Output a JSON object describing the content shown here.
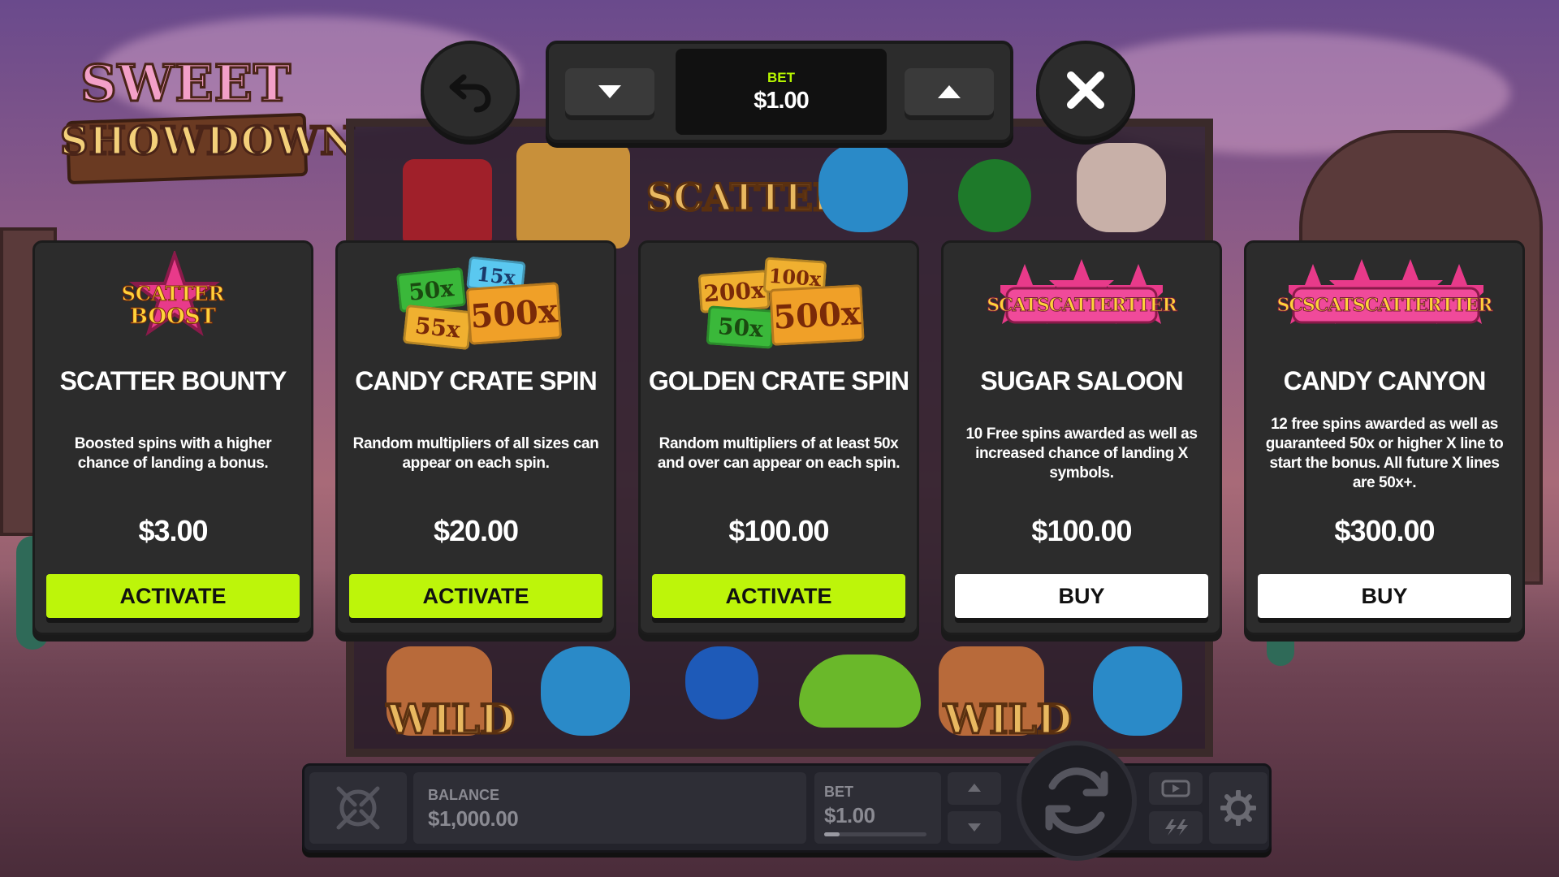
{
  "logo": {
    "line1": "SWEET",
    "line2": "SHOWDOWN"
  },
  "top_bar": {
    "back_icon": "undo-arrow-icon",
    "close_icon": "close-icon",
    "bet_label": "BET",
    "bet_value": "$1.00",
    "decrease_icon": "triangle-down-icon",
    "increase_icon": "triangle-up-icon"
  },
  "cards": [
    {
      "art": {
        "badge_line1": "SCATTER",
        "badge_line2": "BOOST"
      },
      "title": "SCATTER BOUNTY",
      "desc": [
        "Boosted spins with a higher",
        "chance of landing a bonus."
      ],
      "price": "$3.00",
      "cta": "ACTIVATE"
    },
    {
      "art": {
        "tiles": [
          "50x",
          "15x",
          "55x",
          "500x"
        ]
      },
      "title": "CANDY CRATE SPIN",
      "desc": [
        "Random multipliers of all sizes can",
        "appear on each spin."
      ],
      "price": "$20.00",
      "cta": "ACTIVATE"
    },
    {
      "art": {
        "tiles": [
          "200x",
          "100x",
          "50x",
          "500x"
        ]
      },
      "title": "GOLDEN CRATE SPIN",
      "desc": [
        "Random multipliers of at least 50x",
        "and over can appear on each spin."
      ],
      "price": "$100.00",
      "cta": "ACTIVATE"
    },
    {
      "art": {
        "badge_text": "SCATSCATTERTTER"
      },
      "title": "SUGAR SALOON",
      "desc": [
        "10 Free spins awarded as well as",
        "increased chance of landing X",
        "symbols."
      ],
      "price": "$100.00",
      "cta": "BUY"
    },
    {
      "art": {
        "badge_text": "SCSCATSCATTERTTER"
      },
      "title": "CANDY CANYON",
      "desc": [
        "12 free spins awarded as well as",
        "guaranteed 50x or higher X line to",
        "start the bonus. All future X lines",
        "are 50x+."
      ],
      "price": "$300.00",
      "cta": "BUY"
    }
  ],
  "reels": {
    "wild_label": "WILD",
    "scatter_label": "SCATTER"
  },
  "bottom_bar": {
    "balance_label": "BALANCE",
    "balance_value": "$1,000.00",
    "bet_label": "BET",
    "bet_value": "$1.00",
    "bet_progress": 0.15,
    "icons": [
      "compass-logo-icon",
      "triangle-up-icon",
      "triangle-down-icon",
      "spin-icon",
      "autoplay-icon",
      "turbo-icon",
      "gear-icon"
    ]
  },
  "colors": {
    "accent": "#bdf50a",
    "card_bg": "#2c2c2c",
    "buy_bg": "#ffffff"
  }
}
